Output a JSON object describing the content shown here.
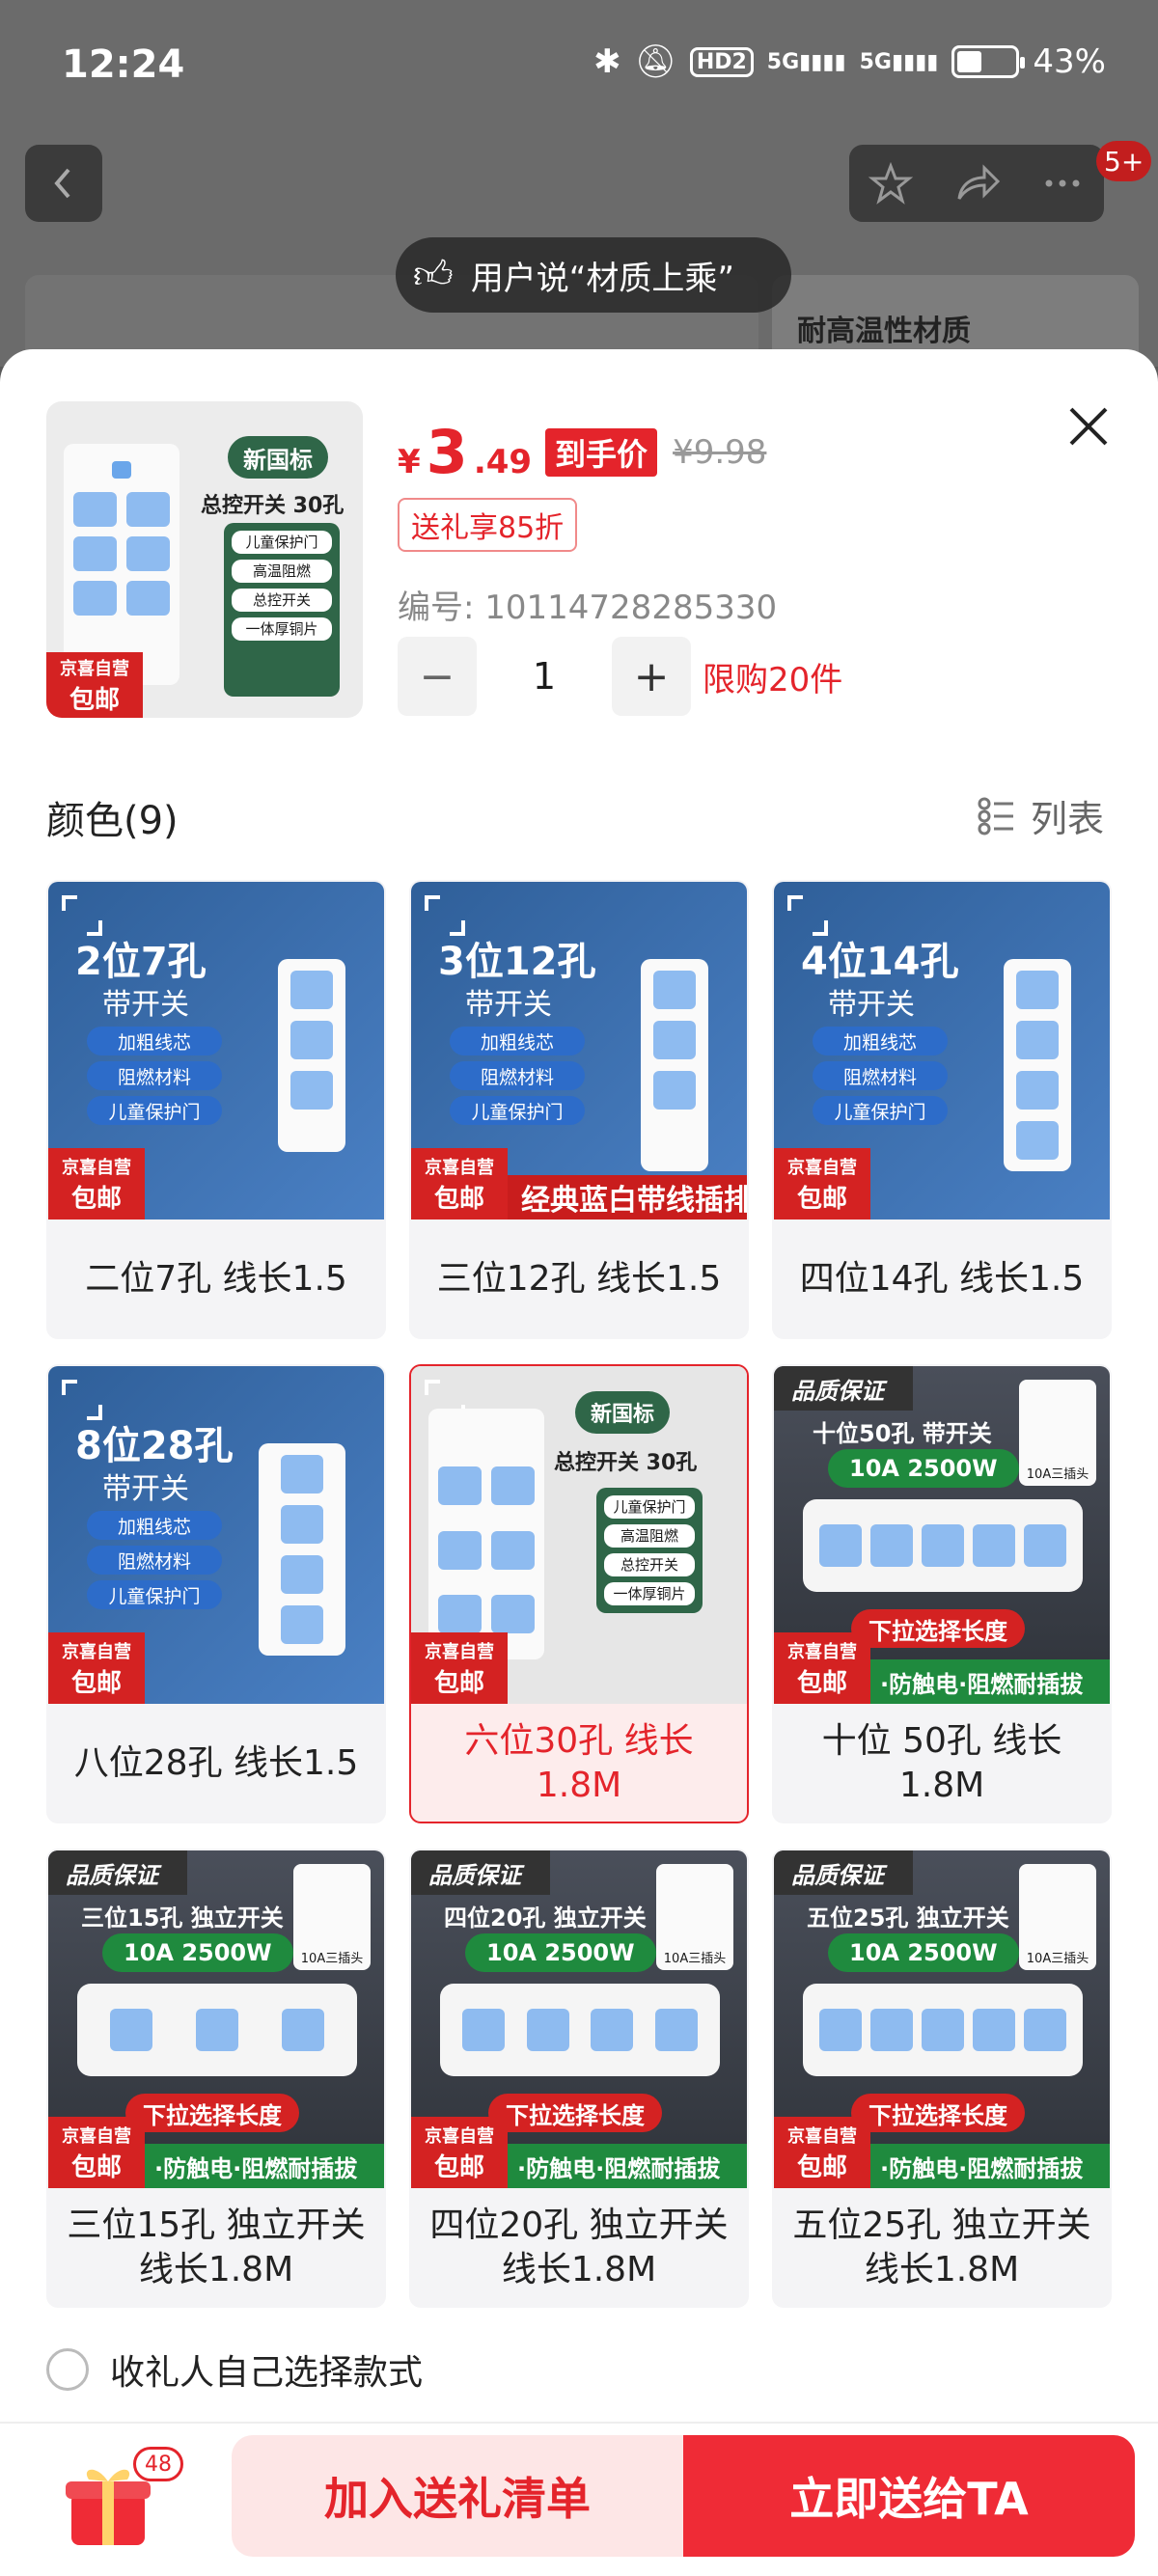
{
  "status_bar": {
    "time": "12:24",
    "hd_label": "HD2",
    "net1": "5G",
    "net2": "5G",
    "battery_percent": "43%",
    "battery_level": 0.43
  },
  "top_nav": {
    "cart_badge": "5+"
  },
  "banner": {
    "text": "用户说“材质上乘”"
  },
  "background_peek": {
    "text": "耐高温性材质"
  },
  "product": {
    "price_symbol": "¥",
    "price_integer": "3",
    "price_decimal": ".49",
    "price_tag": "到手价",
    "original_price": "¥9.98",
    "promo": "送礼享85折",
    "sku": "编号: 10114728285330",
    "quantity": "1",
    "limit": "限购20件",
    "thumb": {
      "head": "新国标",
      "title": "总控开关 30孔",
      "lines": [
        "儿童保护门",
        "高温阻燃",
        "总控开关",
        "一体厚铜片"
      ]
    }
  },
  "options_section": {
    "title": "颜色(9)",
    "view_toggle": "列表"
  },
  "variants": [
    {
      "label": "二位7孔 线长1.5",
      "img_title": "2位7孔",
      "img_sub": "带开关",
      "pills": [
        "加粗线芯",
        "阻燃材料",
        "儿童保护门"
      ],
      "bar": "",
      "style": "blue"
    },
    {
      "label": "三位12孔 线长1.5",
      "img_title": "3位12孔",
      "img_sub": "带开关",
      "pills": [
        "加粗线芯",
        "阻燃材料",
        "儿童保护门"
      ],
      "bar": "经典蓝白带线插排",
      "style": "blue"
    },
    {
      "label": "四位14孔 线长1.5",
      "img_title": "4位14孔",
      "img_sub": "带开关",
      "pills": [
        "加粗线芯",
        "阻燃材料",
        "儿童保护门"
      ],
      "bar": "",
      "style": "blue"
    },
    {
      "label": "八位28孔 线长1.5",
      "img_title": "8位28孔",
      "img_sub": "带开关",
      "pills": [
        "加粗线芯",
        "阻燃材料",
        "儿童保护门"
      ],
      "bar": "",
      "style": "blue"
    },
    {
      "label": "六位30孔 线长1.8M",
      "img_title": "新国标",
      "img_sub": "总控开关 30孔",
      "pills": [
        "儿童保护门",
        "高温阻燃",
        "总控开关",
        "一体厚铜片"
      ],
      "bar": "",
      "style": "gray",
      "selected": true
    },
    {
      "label": "十位 50孔 线长1.8M",
      "img_title": "十位50孔 带开关",
      "img_sub": "10A 2500W",
      "pills": [],
      "bar": "·防触电·阻燃耐插拔",
      "style": "dark"
    },
    {
      "label": "三位15孔 独立开关 线长1.8M",
      "img_title": "三位15孔 独立开关",
      "img_sub": "10A 2500W",
      "pills": [],
      "bar": "·防触电·阻燃耐插拔",
      "style": "dark"
    },
    {
      "label": "四位20孔 独立开关 线长1.8M",
      "img_title": "四位20孔 独立开关",
      "img_sub": "10A 2500W",
      "pills": [],
      "bar": "·防触电·阻燃耐插拔",
      "style": "dark"
    },
    {
      "label": "五位25孔 独立开关 线长1.8M",
      "img_title": "五位25孔 独立开关",
      "img_sub": "10A 2500W",
      "pills": [],
      "bar": "·防触电·阻燃耐插拔",
      "style": "dark"
    }
  ],
  "badges": {
    "jd_top": "京喜自营",
    "jd_bottom": "包邮",
    "quality": "品质保证",
    "pull_down": "下拉选择长度",
    "plug": "10A三插头"
  },
  "gift_option": {
    "label": "收礼人自己选择款式"
  },
  "bottom_bar": {
    "gift_count": "48",
    "add_button": "加入送礼清单",
    "send_button": "立即送给TA"
  },
  "colors": {
    "accent": "#e4242b",
    "selected_bg": "#fdecec"
  }
}
